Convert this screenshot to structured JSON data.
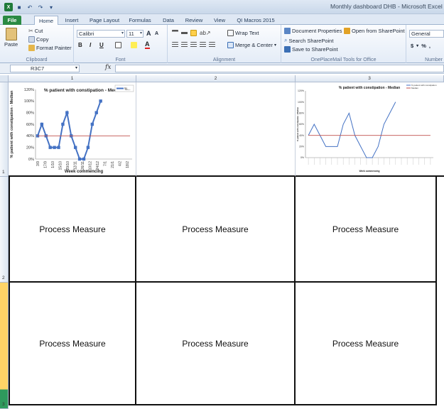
{
  "window": {
    "title": "Monthly dashboard DHB - Microsoft Excel"
  },
  "ribbon_tabs": [
    "File",
    "Home",
    "Insert",
    "Page Layout",
    "Formulas",
    "Data",
    "Review",
    "View",
    "QI Macros 2015"
  ],
  "clipboard": {
    "paste": "Paste",
    "cut": "Cut",
    "copy": "Copy",
    "format_painter": "Format Painter",
    "label": "Clipboard"
  },
  "font": {
    "name": "Calibri",
    "size": "11",
    "label": "Font",
    "bold": "B",
    "italic": "I",
    "underline": "U",
    "grow": "A",
    "shrink": "A",
    "font_color": "A"
  },
  "alignment": {
    "wrap_text": "Wrap Text",
    "merge_center": "Merge & Center",
    "label": "Alignment"
  },
  "oneplace": {
    "document_properties": "Document Properties",
    "open_sharepoint": "Open from SharePoint",
    "search_sharepoint": "Search SharePoint",
    "save_sharepoint": "Save to SharePoint",
    "label": "OnePlaceMail Tools for Office"
  },
  "number": {
    "format": "General",
    "currency": "$",
    "percent": "%",
    "comma": ",",
    "label": "Number"
  },
  "formula_bar": {
    "name_box": "R3C7",
    "fx": "fx",
    "value": ""
  },
  "columns": [
    "1",
    "2",
    "3"
  ],
  "rows": [
    "1",
    "2",
    "3"
  ],
  "cells": {
    "process_measure": "Process Measure"
  },
  "chart_data": [
    {
      "type": "line",
      "title": "% patient  with  constipation  - Median",
      "legend_label": "%...",
      "ylabel": "% patient with constipation - Median",
      "xlabel": "Week commencing",
      "y_ticks": [
        "0%",
        "20%",
        "40%",
        "60%",
        "80%",
        "100%",
        "120%"
      ],
      "x": [
        "3/9",
        "10/9",
        "17/9",
        "24/9",
        "1/10",
        "8/10",
        "15/10",
        "22/10",
        "29/10",
        "5/11",
        "12/11",
        "19/11",
        "26/11",
        "3/12",
        "10/12",
        "17/12",
        "24/12",
        "31/12",
        "7/1",
        "14/1",
        "21/1",
        "28/1",
        "4/2"
      ],
      "x_tick_labels": [
        "3/9",
        "17/9",
        "1/10",
        "15/10",
        "29/10",
        "12/11",
        "26/11",
        "10/12",
        "24/12",
        "7/1",
        "21/1",
        "4/2",
        "18/2"
      ],
      "series": [
        {
          "name": "",
          "values": [
            40,
            60,
            40,
            20,
            20,
            20,
            60,
            80,
            40,
            20,
            0,
            0,
            20,
            60,
            80,
            100,
            null,
            null,
            null,
            null,
            null,
            null,
            null
          ]
        },
        {
          "name": "",
          "values": [
            40,
            40,
            40,
            40,
            40,
            40,
            40,
            40,
            40,
            40,
            40,
            40,
            40,
            40,
            40,
            40,
            40,
            40,
            40,
            40,
            40,
            40,
            40
          ]
        }
      ],
      "ylim": [
        0,
        120
      ],
      "colors": [
        "#4472c4",
        "#c0504d"
      ]
    },
    {
      "type": "line",
      "title": "% patient with constipation - Median",
      "legend": [
        "% patient with constipation",
        "Median"
      ],
      "ylabel": "% patient with constipation - Median",
      "xlabel": "Week commencing",
      "y_ticks": [
        "0%",
        "20%",
        "40%",
        "60%",
        "80%",
        "100%",
        "120%"
      ],
      "series": [
        {
          "name": "% patient with constipation",
          "values": [
            40,
            60,
            40,
            20,
            20,
            20,
            60,
            80,
            40,
            20,
            0,
            0,
            20,
            60,
            80,
            100
          ]
        },
        {
          "name": "Median",
          "values": [
            40,
            40,
            40,
            40,
            40,
            40,
            40,
            40,
            40,
            40,
            40,
            40,
            40,
            40,
            40,
            40,
            40,
            40,
            40,
            40,
            40,
            40
          ]
        }
      ],
      "ylim": [
        0,
        120
      ],
      "colors": [
        "#4472c4",
        "#c0504d"
      ]
    }
  ]
}
